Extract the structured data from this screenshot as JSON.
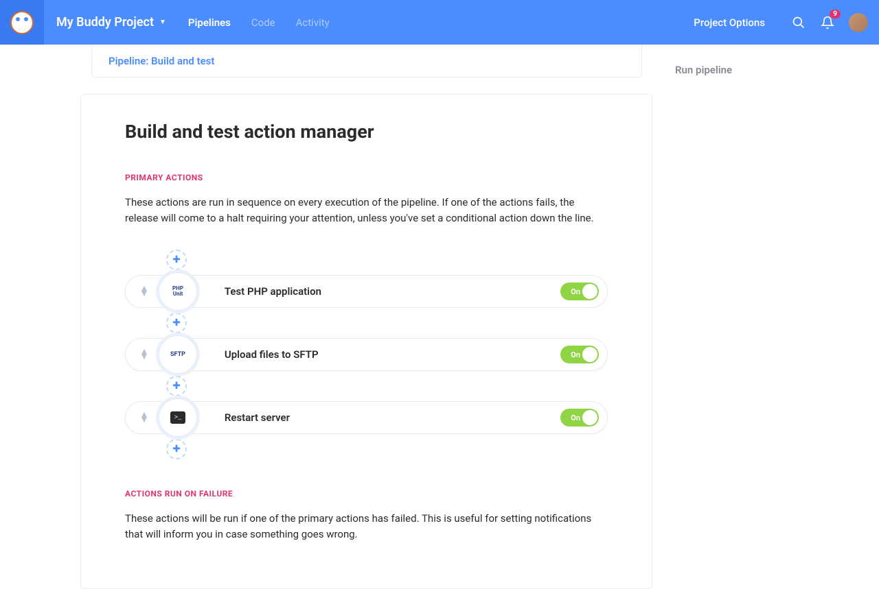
{
  "header": {
    "project_name": "My Buddy Project",
    "nav": {
      "pipelines": "Pipelines",
      "code": "Code",
      "activity": "Activity"
    },
    "project_options": "Project Options",
    "notification_count": "9"
  },
  "breadcrumb": "Pipeline: Build and test",
  "page_title": "Build and test action manager",
  "primary": {
    "label": "PRIMARY ACTIONS",
    "desc": "These actions are run in sequence on every execution of the pipeline. If one of the actions fails, the release will come to a halt requiring your attention, unless you've set a conditional action down the line."
  },
  "actions": [
    {
      "icon_line1": "PHP",
      "icon_line2": "Unit",
      "label": "Test PHP application",
      "toggle": "On"
    },
    {
      "icon_line1": "SFTP",
      "icon_line2": "",
      "label": "Upload files to SFTP",
      "toggle": "On"
    },
    {
      "icon_type": "terminal",
      "label": "Restart server",
      "toggle": "On"
    }
  ],
  "failure": {
    "label": "ACTIONS RUN ON FAILURE",
    "desc": "These actions will be run if one of the primary actions has failed. This is useful for setting notifications that will inform you in case something goes wrong."
  },
  "sidebar": {
    "run_pipeline": "Run pipeline"
  }
}
